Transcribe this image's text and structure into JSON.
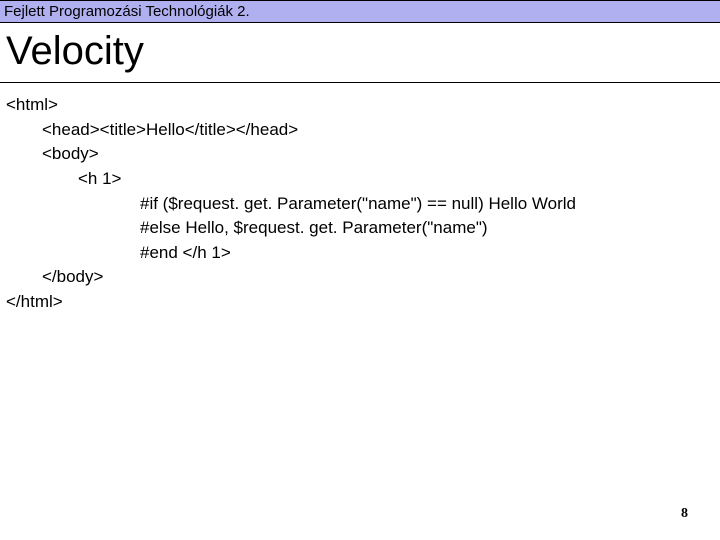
{
  "header": "Fejlett Programozási Technológiák 2.",
  "title": "Velocity",
  "code": {
    "l1": "<html>",
    "l2": "<head><title>Hello</title></head>",
    "l3": "<body>",
    "l4": "<h 1>",
    "l5": "#if ($request. get. Parameter(\"name\") == null) Hello World",
    "l6": "#else Hello, $request. get. Parameter(\"name\")",
    "l7": "#end </h 1>",
    "l8": "</body>",
    "l9": "</html>"
  },
  "pageNumber": "8"
}
